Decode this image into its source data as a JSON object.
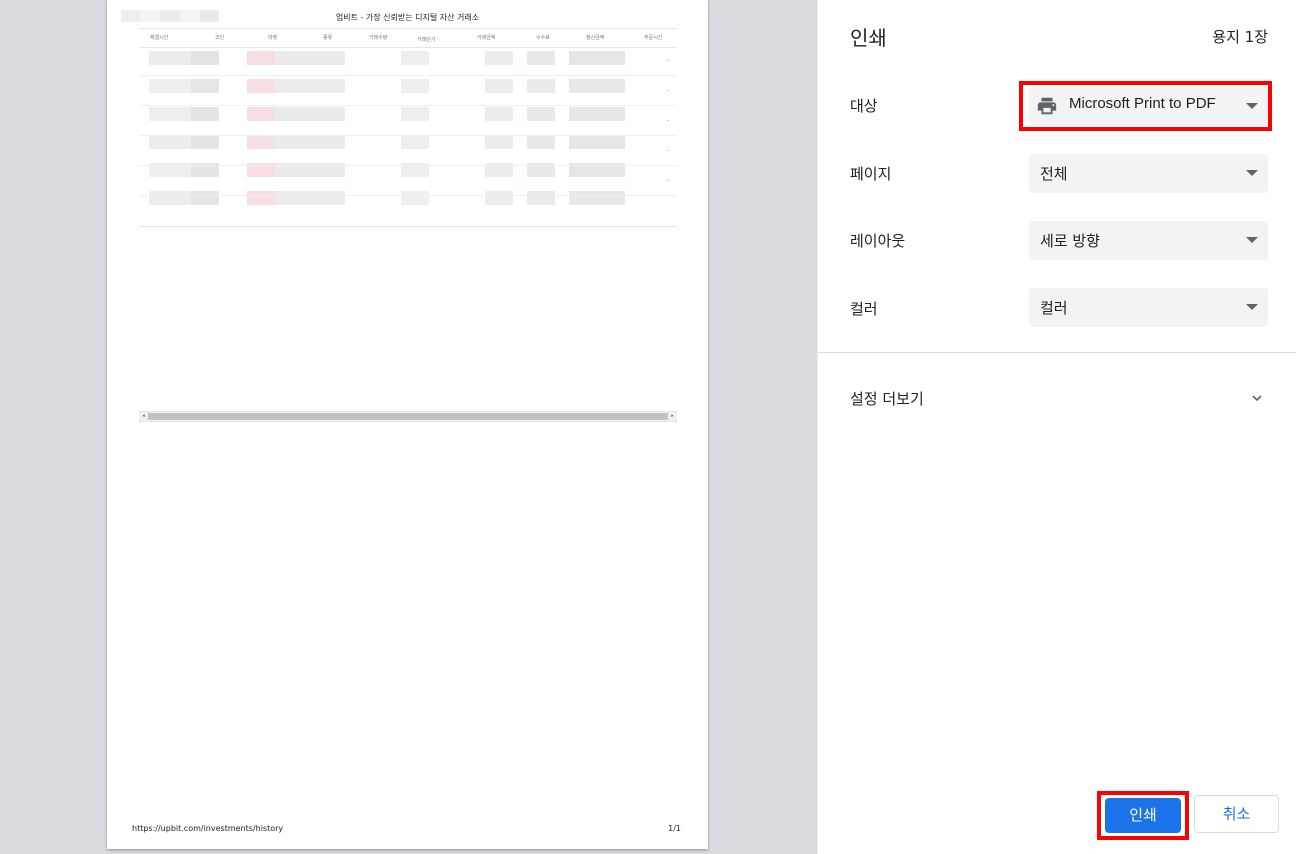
{
  "preview": {
    "page_title": "업비트 - 가장 신뢰받는 디지털 자산 거래소",
    "table_headers": [
      "체결시간",
      "코인",
      "마켓",
      "종류",
      "거래수량",
      "거래단가",
      "거래금액",
      "수수료",
      "정산금액",
      "주문시간"
    ],
    "row_dash": "-",
    "footer_url": "https://upbit.com/investments/history",
    "footer_page": "1/1"
  },
  "settings": {
    "title": "인쇄",
    "sheet_count": "용지 1장",
    "destination": {
      "label": "대상",
      "value": "Microsoft Print to PDF",
      "icon": "printer-icon"
    },
    "pages": {
      "label": "페이지",
      "value": "전체"
    },
    "layout": {
      "label": "레이아웃",
      "value": "세로 방향"
    },
    "color": {
      "label": "컬러",
      "value": "컬러"
    },
    "more_settings": {
      "label": "설정 더보기",
      "icon": "chevron-down-icon"
    }
  },
  "buttons": {
    "print": "인쇄",
    "cancel": "취소"
  },
  "colors": {
    "accent": "#1a73e8",
    "highlight": "#ff0000",
    "preview_background": "#dadce0",
    "select_background": "#f1f3f4"
  }
}
